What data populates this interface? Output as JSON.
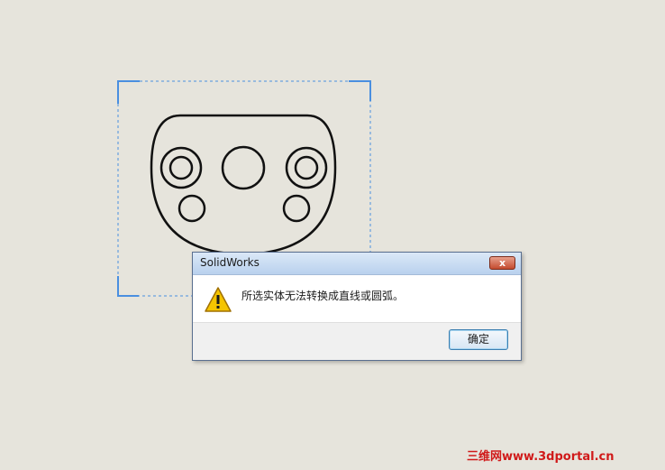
{
  "dialog": {
    "title": "SolidWorks",
    "message": "所选实体无法转换成直线或圆弧。",
    "ok_label": "确定",
    "close_label": "x"
  },
  "watermark": "三维网www.3dportal.cn",
  "colors": {
    "background": "#e6e4dc",
    "selection_corner": "#4a8fe0",
    "sketch_line": "#111111",
    "watermark": "#d01a1a"
  },
  "icons": {
    "warning": "warning-icon",
    "close": "close-icon"
  }
}
